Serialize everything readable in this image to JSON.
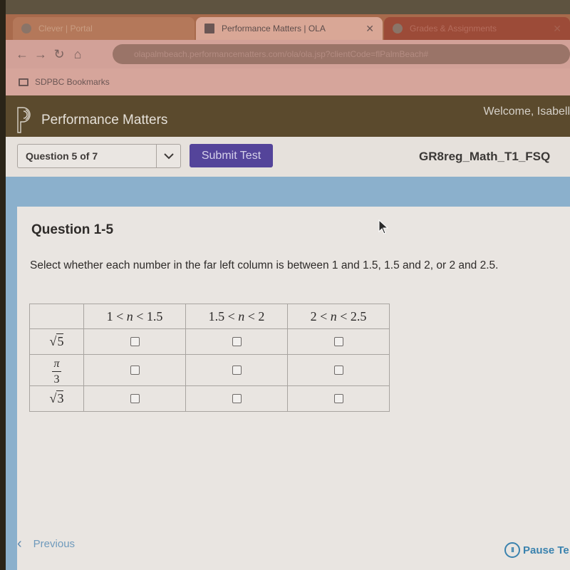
{
  "browser": {
    "tabs": [
      {
        "title": "Clever | Portal",
        "active": false
      },
      {
        "title": "Performance Matters | OLA",
        "active": true
      },
      {
        "title": "Grades & Assignments",
        "active": false
      }
    ],
    "close_glyph": "✕",
    "nav": {
      "back": "←",
      "forward": "→",
      "reload": "↻",
      "home": "⌂"
    },
    "url": "olapalmbeach.performancematters.com/ola/ola.jsp?clientCode=flPalmBeach#",
    "bookmarks_folder": "SDPBC Bookmarks"
  },
  "header": {
    "brand": "Performance Matters",
    "welcome": "Welcome, Isabell"
  },
  "question_bar": {
    "question_select": "Question 5 of 7",
    "submit_label": "Submit Test",
    "test_name": "GR8reg_Math_T1_FSQ"
  },
  "question": {
    "title": "Question 1-5",
    "prompt": "Select whether each number in the far left column is between 1 and 1.5, 1.5 and 2, or 2 and 2.5.",
    "columns": [
      {
        "lo": "1",
        "hi": "1.5"
      },
      {
        "lo": "1.5",
        "hi": "2"
      },
      {
        "lo": "2",
        "hi": "2.5"
      }
    ],
    "variable": "n",
    "rows": [
      {
        "label": "√5",
        "type": "sqrt",
        "radicand": "5",
        "checked": [
          false,
          false,
          false
        ]
      },
      {
        "label": "π/3",
        "type": "frac",
        "numerator": "π",
        "denominator": "3",
        "checked": [
          false,
          false,
          false
        ]
      },
      {
        "label": "√3",
        "type": "sqrt",
        "radicand": "3",
        "checked": [
          false,
          false,
          false
        ]
      }
    ]
  },
  "footer": {
    "previous_label": "Previous",
    "pause_label": "Pause Te",
    "pause_icon_glyph": "II"
  },
  "colors": {
    "header_bg": "#5b4a2d",
    "submit_bg": "#54449a",
    "content_bg": "#8bb0cc",
    "link": "#3a82ae"
  }
}
